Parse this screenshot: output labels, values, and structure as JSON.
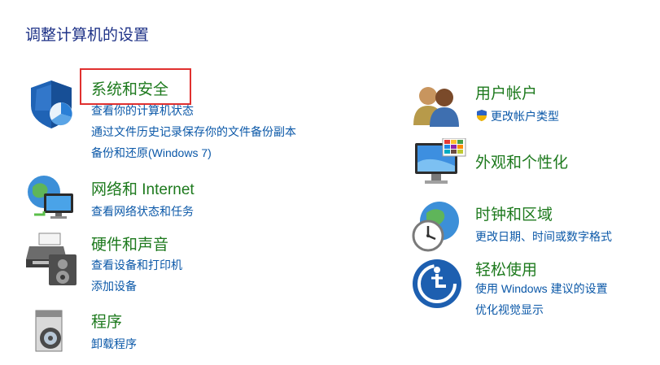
{
  "page_title": "调整计算机的设置",
  "highlight_color": "#e0302f",
  "categories": [
    {
      "title": "系统和安全",
      "icon": "shield-icon",
      "links": [
        "查看你的计算机状态",
        "通过文件历史记录保存你的文件备份副本",
        "备份和还原(Windows 7)"
      ]
    },
    {
      "title": "网络和 Internet",
      "icon": "network-globe-icon",
      "links": [
        "查看网络状态和任务"
      ]
    },
    {
      "title": "硬件和声音",
      "icon": "printer-speaker-icon",
      "links": [
        "查看设备和打印机",
        "添加设备"
      ]
    },
    {
      "title": "程序",
      "icon": "programs-disc-icon",
      "links": [
        "卸载程序"
      ]
    },
    {
      "title": "用户帐户",
      "icon": "users-icon",
      "links": [
        "更改帐户类型"
      ]
    },
    {
      "title": "外观和个性化",
      "icon": "monitor-palette-icon",
      "links": []
    },
    {
      "title": "时钟和区域",
      "icon": "clock-globe-icon",
      "links": [
        "更改日期、时间或数字格式"
      ]
    },
    {
      "title": "轻松使用",
      "icon": "ease-of-access-icon",
      "links": [
        "使用 Windows 建议的设置",
        "优化视觉显示"
      ]
    }
  ]
}
